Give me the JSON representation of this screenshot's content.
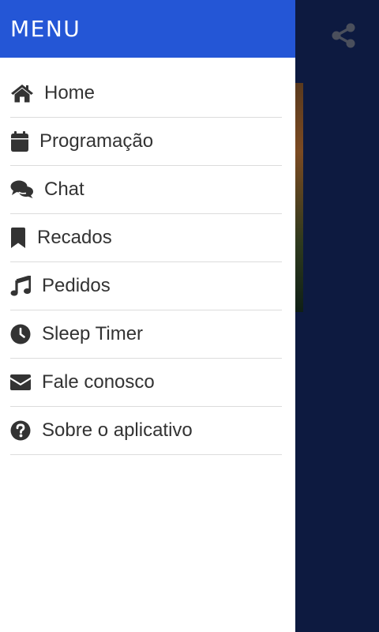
{
  "drawer": {
    "title": "MENU",
    "header_color": "#2456d6"
  },
  "menu": [
    {
      "label": "Home",
      "icon": "home-icon"
    },
    {
      "label": "Programação",
      "icon": "calendar-icon"
    },
    {
      "label": "Chat",
      "icon": "chat-icon"
    },
    {
      "label": "Recados",
      "icon": "bookmark-icon"
    },
    {
      "label": "Pedidos",
      "icon": "music-icon"
    },
    {
      "label": "Sleep Timer",
      "icon": "clock-icon"
    },
    {
      "label": "Fale conosco",
      "icon": "envelope-icon"
    },
    {
      "label": "Sobre o aplicativo",
      "icon": "question-circle-icon"
    }
  ],
  "app": {
    "background_color": "#0d1a40",
    "share_icon": "share-icon"
  }
}
